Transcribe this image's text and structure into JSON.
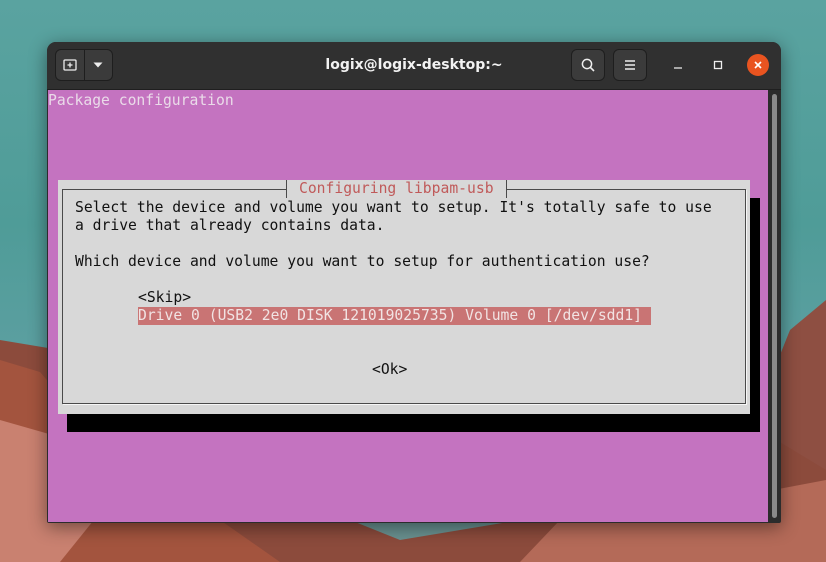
{
  "window": {
    "title": "logix@logix-desktop:~",
    "new_tab_icon": "new-tab-icon",
    "menu_dropdown_icon": "chevron-down-icon",
    "search_icon": "search-icon",
    "hamburger_icon": "hamburger-menu-icon",
    "minimize_icon": "minimize-icon",
    "maximize_icon": "maximize-icon",
    "close_icon": "close-icon"
  },
  "terminal": {
    "header": "Package configuration",
    "dialog": {
      "title": "Configuring libpam-usb",
      "description_line1": "Select the device and volume you want to setup. It's totally safe to use",
      "description_line2": "a drive that already contains data.",
      "question": "Which device and volume you want to setup for authentication use?",
      "options": [
        {
          "label": "<Skip>",
          "selected": false
        },
        {
          "label": "Drive 0 (USB2 2e0 DISK 121019025735) Volume 0 [/dev/sdd1]",
          "selected": true
        }
      ],
      "ok_button": "<Ok>"
    }
  },
  "colors": {
    "terminal_bg": "#c473c0",
    "dialog_bg": "#d8d8d8",
    "dialog_title": "#c05a5a",
    "selection_bg": "#c97474",
    "headerbar_bg": "#303030",
    "close_button": "#e95420"
  }
}
